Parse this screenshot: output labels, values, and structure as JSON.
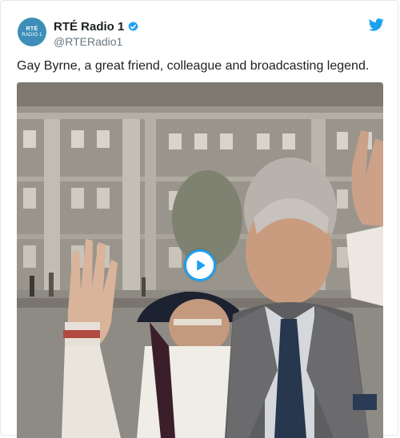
{
  "account": {
    "avatar_line1": "RTÉ",
    "avatar_line2": "RADIO 1",
    "display_name": "RTÉ Radio 1",
    "handle": "@RTERadio1",
    "verified": true
  },
  "tweet": {
    "text": "Gay Byrne, a great friend, colleague and broadcasting legend."
  },
  "media": {
    "type": "video",
    "play_icon": "play-icon"
  },
  "icons": {
    "brand": "twitter-bird-icon",
    "verified": "verified-badge-icon"
  },
  "colors": {
    "brand_blue": "#1da1f2",
    "text": "#1c2022",
    "secondary_text": "#697882",
    "border": "#e1e8ed"
  }
}
